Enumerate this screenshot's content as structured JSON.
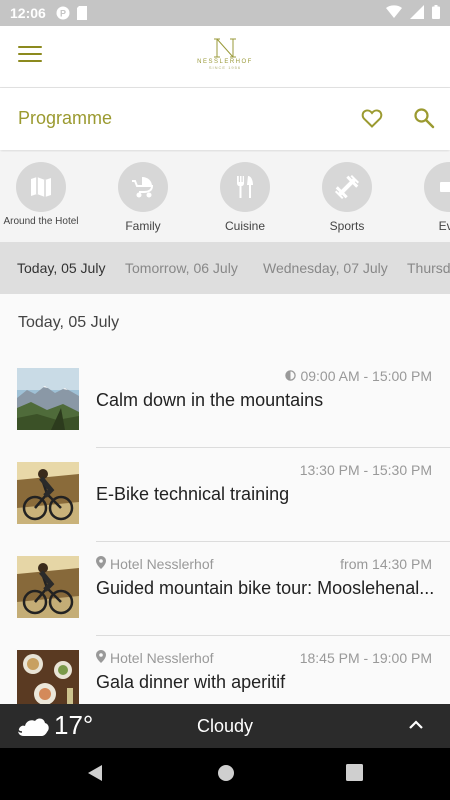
{
  "status_bar": {
    "time": "12:06"
  },
  "logo": {
    "brand": "NESSLERHOF",
    "sub": "SINCE 1956"
  },
  "header": {
    "title": "Programme"
  },
  "categories": [
    {
      "label": "Around the Hotel",
      "icon": "map-icon"
    },
    {
      "label": "Family",
      "icon": "stroller-icon"
    },
    {
      "label": "Cuisine",
      "icon": "cutlery-icon"
    },
    {
      "label": "Sports",
      "icon": "dumbbell-icon"
    },
    {
      "label": "Eve",
      "icon": "event-icon"
    }
  ],
  "date_tabs": [
    {
      "label": "Today, 05 July",
      "active": true
    },
    {
      "label": "Tomorrow, 06 July",
      "active": false
    },
    {
      "label": "Wednesday, 07 July",
      "active": false
    },
    {
      "label": "Thursd",
      "active": false
    }
  ],
  "list": {
    "heading": "Today, 05 July",
    "items": [
      {
        "time": "09:00 AM - 15:00 PM",
        "time_icon": "half-day-icon",
        "location": "",
        "name": "Calm down in the mountains",
        "thumb": "mountains"
      },
      {
        "time": "13:30 PM - 15:30 PM",
        "location": "",
        "name": "E-Bike technical training",
        "thumb": "bike"
      },
      {
        "time": "from 14:30 PM",
        "location": "Hotel Nesslerhof",
        "name": "Guided mountain bike tour: Mooslehenal...",
        "thumb": "bike"
      },
      {
        "time": "18:45 PM - 19:00 PM",
        "location": "Hotel Nesslerhof",
        "name": "Gala dinner with aperitif",
        "thumb": "dinner"
      }
    ]
  },
  "weather": {
    "temperature": "17°",
    "condition": "Cloudy"
  },
  "colors": {
    "accent": "#9b9a30",
    "weather_bg": "#2b2b2b",
    "category_circle": "#d7d7d7"
  }
}
